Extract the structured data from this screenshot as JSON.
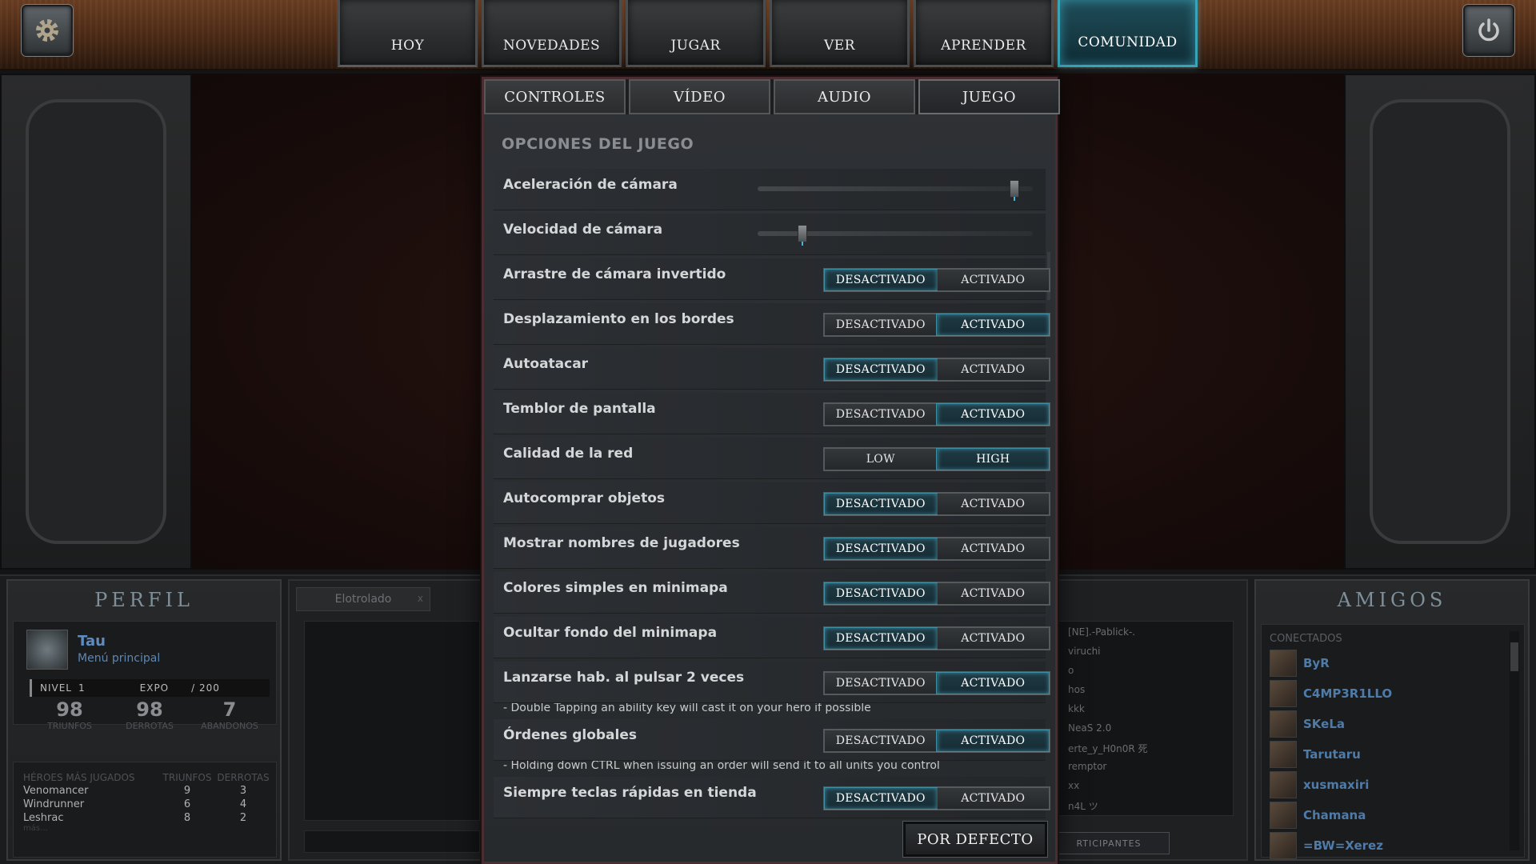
{
  "topbar": {
    "settings_icon": "gear-icon",
    "power_icon": "power-icon",
    "tabs": [
      {
        "label": "HOY"
      },
      {
        "label": "NOVEDADES"
      },
      {
        "label": "JUGAR"
      },
      {
        "label": "VER"
      },
      {
        "label": "APRENDER"
      },
      {
        "label": "COMUNIDAD",
        "active": true
      }
    ]
  },
  "settings": {
    "tabs": [
      {
        "label": "CONTROLES"
      },
      {
        "label": "VÍDEO"
      },
      {
        "label": "AUDIO"
      },
      {
        "label": "JUEGO",
        "active": true
      }
    ],
    "section_title": "OPCIONES DEL JUEGO",
    "sliders": [
      {
        "label": "Aceleración de cámara",
        "value": 0.95
      },
      {
        "label": "Velocidad de cámara",
        "value": 0.15
      }
    ],
    "toggles": [
      {
        "label": "Arrastre de cámara invertido",
        "off": "DESACTIVADO",
        "on": "ACTIVADO",
        "selected": "off"
      },
      {
        "label": "Desplazamiento en los bordes",
        "off": "DESACTIVADO",
        "on": "ACTIVADO",
        "selected": "on"
      },
      {
        "label": "Autoatacar",
        "off": "DESACTIVADO",
        "on": "ACTIVADO",
        "selected": "off"
      },
      {
        "label": "Temblor de pantalla",
        "off": "DESACTIVADO",
        "on": "ACTIVADO",
        "selected": "on"
      },
      {
        "label": "Calidad de la red",
        "off": "LOW",
        "on": "HIGH",
        "selected": "on"
      },
      {
        "label": "Autocomprar objetos",
        "off": "DESACTIVADO",
        "on": "ACTIVADO",
        "selected": "off"
      },
      {
        "label": "Mostrar nombres de jugadores",
        "off": "DESACTIVADO",
        "on": "ACTIVADO",
        "selected": "off"
      },
      {
        "label": "Colores simples en minimapa",
        "off": "DESACTIVADO",
        "on": "ACTIVADO",
        "selected": "off"
      },
      {
        "label": "Ocultar fondo del minimapa",
        "off": "DESACTIVADO",
        "on": "ACTIVADO",
        "selected": "off"
      },
      {
        "label": "Lanzarse hab. al pulsar 2 veces",
        "off": "DESACTIVADO",
        "on": "ACTIVADO",
        "selected": "on"
      },
      {
        "label": "Órdenes globales",
        "off": "DESACTIVADO",
        "on": "ACTIVADO",
        "selected": "on"
      },
      {
        "label": "Siempre teclas rápidas en tienda",
        "off": "DESACTIVADO",
        "on": "ACTIVADO",
        "selected": "off"
      }
    ],
    "desc_double_tap": "- Double Tapping an ability key will cast it on your hero if possible",
    "desc_global_orders": "- Holding down CTRL when issuing an order will send it to all units you control",
    "default_button": "POR DEFECTO"
  },
  "profile": {
    "title": "PERFIL",
    "name": "Tau",
    "subtitle": "Menú principal",
    "level_label": "NIVEL",
    "level": "1",
    "exp_label": "EXPO",
    "exp_max": "/ 200",
    "wins": "98",
    "wins_label": "TRIUNFOS",
    "losses": "98",
    "losses_label": "DERROTAS",
    "abandons": "7",
    "abandons_label": "ABANDONOS",
    "heroes_title": "HÉROES MÁS JUGADOS",
    "heroes_col_wins": "TRIUNFOS",
    "heroes_col_losses": "DERROTAS",
    "heroes": [
      {
        "name": "Venomancer",
        "wins": "9",
        "losses": "3"
      },
      {
        "name": "Windrunner",
        "wins": "6",
        "losses": "4"
      },
      {
        "name": "Leshrac",
        "wins": "8",
        "losses": "2"
      }
    ],
    "more": "más..."
  },
  "chat": {
    "tab1": "Elotrolado",
    "tab1_close": "x",
    "participants": [
      "[NE].-Pablick-.",
      "viruchi",
      "o",
      "hos",
      "kkk",
      "NeaS 2.0",
      "erte_y_H0n0R 死",
      "remptor",
      "xx",
      "n4L ツ"
    ],
    "participants_button": "RTICIPANTES"
  },
  "friends": {
    "title": "AMIGOS",
    "online_label": "CONECTADOS",
    "list": [
      "ByR",
      "C4MP3R1LLO",
      "SKeLa",
      "Tarutaru",
      "xusmaxiri",
      "Chamana",
      "=BW=Xerez"
    ]
  }
}
